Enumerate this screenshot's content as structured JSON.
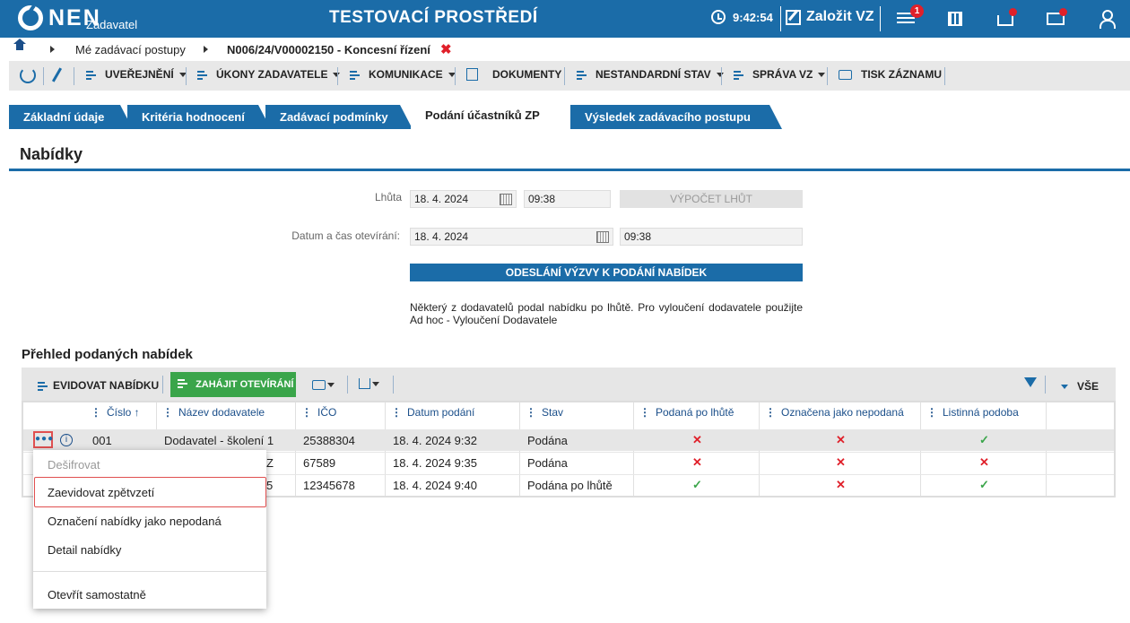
{
  "header": {
    "logo": "NEN",
    "logo_sub": "Zadavatel",
    "env_title": "TESTOVACÍ PROSTŘEDÍ",
    "time": "9:42:54",
    "create_vz": "Založit VZ",
    "notification_count": "1",
    "accent_color": "#1b6ca8"
  },
  "breadcrumb": {
    "items": [
      "Mé zadávací postupy",
      "N006/24/V00002150 - Koncesní řízení"
    ],
    "close": "✖"
  },
  "toolbar": {
    "items": [
      "UVEŘEJNĚNÍ",
      "ÚKONY ZADAVATELE",
      "KOMUNIKACE",
      "DOKUMENTY",
      "NESTANDARDNÍ STAV",
      "SPRÁVA VZ",
      "TISK ZÁZNAMU"
    ]
  },
  "tabs": [
    {
      "label": "Základní údaje"
    },
    {
      "label": "Kritéria hodnocení"
    },
    {
      "label": "Zadávací podmínky"
    },
    {
      "label": "Podání účastníků ZP",
      "active": true
    },
    {
      "label": "Výsledek zadávacího postupu"
    }
  ],
  "section": {
    "title": "Nabídky",
    "lhuta_label": "Lhůta",
    "lhuta_date": "18. 4. 2024",
    "lhuta_time": "09:38",
    "calc_button": "VÝPOČET LHŮT",
    "open_label": "Datum a čas otevírání:",
    "open_date": "18. 4. 2024",
    "open_time": "09:38",
    "send_button": "ODESLÁNÍ VÝZVY K PODÁNÍ NABÍDEK",
    "notice": "Některý z dodavatelů podal nabídku po lhůtě. Pro vyloučení dodavatele použijte Ad hoc - Vyloučení Dodavatele"
  },
  "offers": {
    "title": "Přehled podaných nabídek",
    "evidovat": "EVIDOVAT NABÍDKU",
    "zahajit": "ZAHÁJIT OTEVÍRÁNÍ",
    "filter_all": "VŠE",
    "columns": [
      "Číslo ↑",
      "Název dodavatele",
      "IČO",
      "Datum podání",
      "Stav",
      "Podaná po lhůtě",
      "Označena jako nepodaná",
      "Listinná podoba"
    ],
    "rows": [
      {
        "cislo": "001",
        "nazev": "Dodavatel - školení 1",
        "ico": "25388304",
        "datum": "18. 4. 2024 9:32",
        "stav": "Podána",
        "po_lhute": "✕",
        "nepodana": "✕",
        "listinna": "✓"
      },
      {
        "cislo": "",
        "nazev": "Z",
        "ico": "67589",
        "datum": "18. 4. 2024 9:35",
        "stav": "Podána",
        "po_lhute": "✕",
        "nepodana": "✕",
        "listinna": "✕"
      },
      {
        "cislo": "",
        "nazev": "5",
        "ico": "12345678",
        "datum": "18. 4. 2024 9:40",
        "stav": "Podána po lhůtě",
        "po_lhute": "✓",
        "nepodana": "✕",
        "listinna": "✓"
      }
    ]
  },
  "context_menu": {
    "items": [
      "Dešifrovat",
      "Zaevidovat zpětvzetí",
      "Označení nabídky jako nepodaná",
      "Detail nabídky",
      "Otevřít samostatně"
    ]
  }
}
